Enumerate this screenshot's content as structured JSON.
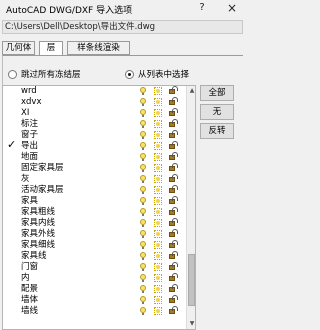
{
  "window": {
    "title": "AutoCAD DWG/DXF 导入选项",
    "help": "?",
    "close": "×"
  },
  "file_path": "C:\\Users\\Dell\\Desktop\\导出文件.dwg",
  "tabs": [
    {
      "label": "几何体",
      "active": false
    },
    {
      "label": "层",
      "active": true
    },
    {
      "label": "样条线渲染",
      "active": false
    }
  ],
  "options": {
    "skip_frozen": {
      "label": "跳过所有冻结层",
      "selected": false
    },
    "select_from_list": {
      "label": "从列表中选择",
      "selected": true
    }
  },
  "buttons": {
    "all": "全部",
    "none": "无",
    "invert": "反转"
  },
  "layers": [
    {
      "name": "wrd",
      "checked": false
    },
    {
      "name": "xdvx",
      "checked": false
    },
    {
      "name": "XI",
      "checked": false
    },
    {
      "name": "标注",
      "checked": false
    },
    {
      "name": "窗子",
      "checked": false
    },
    {
      "name": "导出",
      "checked": true
    },
    {
      "name": "地面",
      "checked": false
    },
    {
      "name": "固定家具层",
      "checked": false
    },
    {
      "name": "灰",
      "checked": false
    },
    {
      "name": "活动家具层",
      "checked": false
    },
    {
      "name": "家具",
      "checked": false
    },
    {
      "name": "家具粗线",
      "checked": false
    },
    {
      "name": "家具内线",
      "checked": false
    },
    {
      "name": "家具外线",
      "checked": false
    },
    {
      "name": "家具细线",
      "checked": false
    },
    {
      "name": "家具线",
      "checked": false
    },
    {
      "name": "门窗",
      "checked": false
    },
    {
      "name": "内",
      "checked": false
    },
    {
      "name": "配景",
      "checked": false
    },
    {
      "name": "墙体",
      "checked": false
    },
    {
      "name": "墙线",
      "checked": false
    }
  ],
  "icons": {
    "layer_on": "lightbulb-icon",
    "layer_thaw": "sun-icon",
    "layer_lock": "lock-icon"
  }
}
